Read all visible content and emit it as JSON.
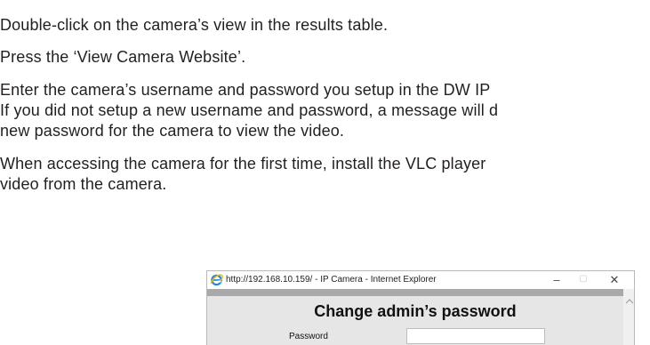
{
  "document": {
    "lines": [
      "Double-click on the camera’s view in the results table.",
      "Press the ‘View Camera Website’.",
      "Enter the camera’s username and password you setup in the DW IP",
      "If you did not setup a new username and password, a message will d",
      "new password for the camera to view the video.",
      "When accessing the camera for the first time, install the VLC player",
      "video from the camera."
    ]
  },
  "browser": {
    "title": "http://192.168.10.159/ - IP Camera - Internet Explorer",
    "controls": {
      "minimize": "–",
      "maximize": "☐",
      "close": "✕"
    }
  },
  "dialog": {
    "title": "Change admin’s password",
    "field_label": "Password"
  },
  "colors": {
    "text": "#231f20",
    "content_bg": "#e6e6e6",
    "toolbar_strip": "#a9a9a9",
    "ie_blue": "#1e88e5",
    "ie_gold": "#f4b400"
  }
}
